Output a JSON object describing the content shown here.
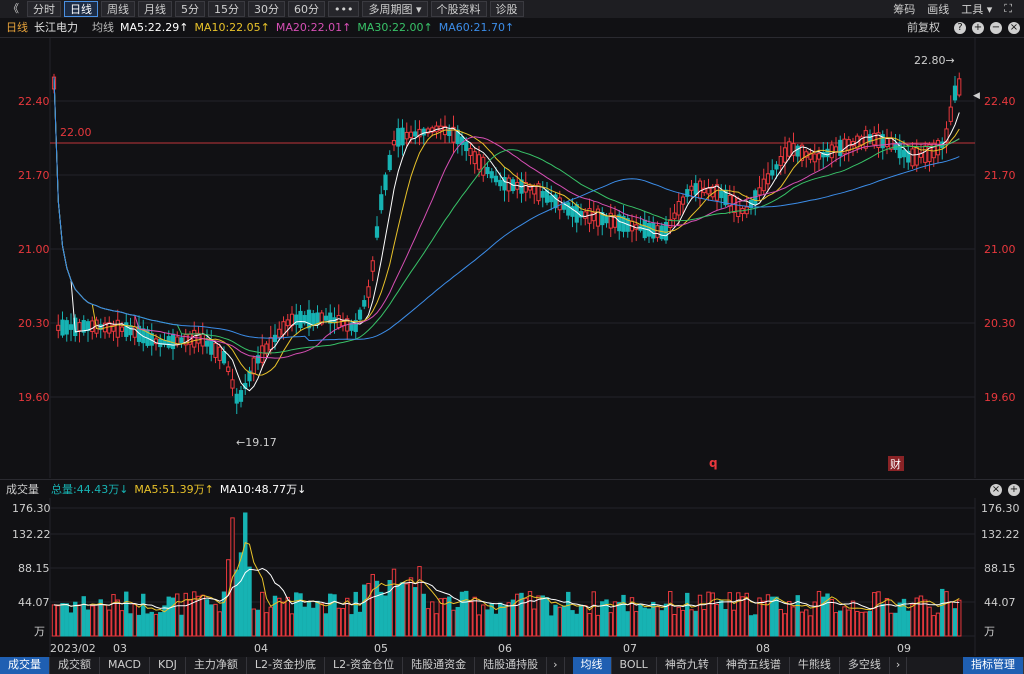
{
  "toolbar": {
    "back": "《",
    "tabs": [
      "分时",
      "日线",
      "周线",
      "月线",
      "5分",
      "15分",
      "30分",
      "60分",
      "•••",
      "多周期图 ▾",
      "个股资料",
      "诊股"
    ],
    "active_tab": 1,
    "right": [
      "筹码",
      "画线",
      "工具 ▾"
    ],
    "expand": "⛶"
  },
  "info": {
    "period": "日线",
    "stock": "长江电力",
    "avg": "均线",
    "ma5": "MA5:22.29↑",
    "ma10": "MA10:22.05↑",
    "ma20": "MA20:22.01↑",
    "ma30": "MA30:22.00↑",
    "ma60": "MA60:21.70↑",
    "adjust": "前复权"
  },
  "price_axis": {
    "ticks": [
      "22.40",
      "21.70",
      "21.00",
      "20.30",
      "19.60"
    ],
    "ref_line": "22.00",
    "high_label": "22.80→",
    "low_label": "←19.17",
    "markers": [
      "q",
      "财"
    ]
  },
  "volume": {
    "title": "成交量",
    "total": "总量:44.43万↓",
    "ma5": "MA5:51.39万↑",
    "ma10": "MA10:48.77万↓",
    "ticks": [
      "176.30",
      "132.22",
      "88.15",
      "44.07"
    ],
    "unit": "万"
  },
  "x_axis": [
    "2023/02",
    "03",
    "04",
    "05",
    "06",
    "07",
    "08",
    "09"
  ],
  "bottom_tabs_left": [
    "成交量",
    "成交额",
    "MACD",
    "KDJ",
    "主力净额",
    "L2-资金抄底",
    "L2-资金仓位",
    "陆股通资金",
    "陆股通持股"
  ],
  "bottom_tabs_right": [
    "均线",
    "BOLL",
    "神奇九转",
    "神奇五线谱",
    "牛熊线",
    "多空线"
  ],
  "bottom_manage": "指标管理",
  "colors": {
    "up": "#e8383d",
    "down": "#17b3b3",
    "ma5": "#ffffff",
    "ma10": "#e8c22a",
    "ma20": "#d64fb4",
    "ma30": "#38c268",
    "ma60": "#3c8de8"
  }
}
